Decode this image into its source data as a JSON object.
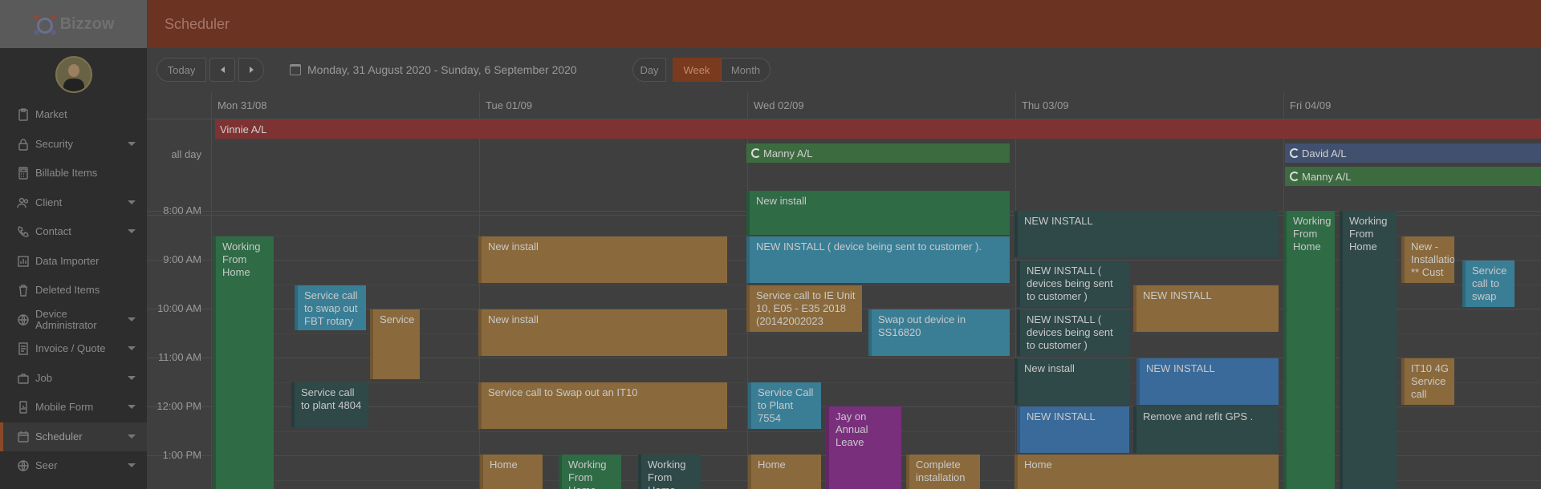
{
  "app": {
    "logo_text": "Bizzow",
    "page_title": "Scheduler"
  },
  "sidebar": {
    "items": [
      {
        "label": "Market",
        "icon": "clipboard-icon",
        "caret": false,
        "active": false
      },
      {
        "label": "Security",
        "icon": "lock-icon",
        "caret": true,
        "active": false
      },
      {
        "label": "Billable Items",
        "icon": "calculator-icon",
        "caret": false,
        "active": false
      },
      {
        "label": "Client",
        "icon": "users-icon",
        "caret": true,
        "active": false
      },
      {
        "label": "Contact",
        "icon": "phone-icon",
        "caret": true,
        "active": false
      },
      {
        "label": "Data Importer",
        "icon": "chart-icon",
        "caret": false,
        "active": false
      },
      {
        "label": "Deleted Items",
        "icon": "trash-icon",
        "caret": false,
        "active": false
      },
      {
        "label": "Device Administrator",
        "icon": "globe-gear-icon",
        "caret": true,
        "active": false
      },
      {
        "label": "Invoice / Quote",
        "icon": "invoice-icon",
        "caret": true,
        "active": false
      },
      {
        "label": "Job",
        "icon": "briefcase-icon",
        "caret": true,
        "active": false
      },
      {
        "label": "Mobile Form",
        "icon": "mobile-chart-icon",
        "caret": true,
        "active": false
      },
      {
        "label": "Scheduler",
        "icon": "calendar-icon",
        "caret": true,
        "active": true
      },
      {
        "label": "Seer",
        "icon": "globe-icon",
        "caret": true,
        "active": false
      }
    ]
  },
  "toolbar": {
    "today": "Today",
    "date_range": "Monday, 31 August 2020 - Sunday, 6 September 2020",
    "views": {
      "day": "Day",
      "week": "Week",
      "month": "Month"
    },
    "active_view": "Week"
  },
  "calendar": {
    "days": [
      "Mon 31/08",
      "Tue 01/09",
      "Wed 02/09",
      "Thu 03/09",
      "Fri 04/09"
    ],
    "allday_label": "all day",
    "times": [
      "8:00 AM",
      "9:00 AM",
      "10:00 AM",
      "11:00 AM",
      "12:00 PM",
      "1:00 PM"
    ],
    "allday_events": [
      {
        "title": "Vinnie A/L",
        "color": "#7e3332",
        "recurring": false
      },
      {
        "title": "Manny A/L",
        "color": "#3d6b40",
        "recurring": true
      },
      {
        "title": "David A/L",
        "color": "#425070",
        "recurring": true
      },
      {
        "title": "Manny A/L",
        "color": "#3d6b40",
        "recurring": true
      }
    ],
    "events": [
      {
        "title": "Working From Home",
        "color": "#2f6b45"
      },
      {
        "title": "Service call to swap out FBT rotary",
        "color": "#3a7e96"
      },
      {
        "title": "Service",
        "color": "#8a6a3c"
      },
      {
        "title": "Service call to plant 4804",
        "color": "#2f4848"
      },
      {
        "title": "New install",
        "color": "#8a6a3c"
      },
      {
        "title": "New install",
        "color": "#8a6a3c"
      },
      {
        "title": "Service call to Swap out an IT10",
        "color": "#8a6a3c"
      },
      {
        "title": "Home",
        "color": "#8a6a3c"
      },
      {
        "title": "Working From Home",
        "color": "#2f6b45"
      },
      {
        "title": "Working From Home",
        "color": "#2f4848"
      },
      {
        "title": "New install",
        "color": "#2f6b45"
      },
      {
        "title": "NEW INSTALL ( device being sent to customer ).",
        "color": "#3a7e96"
      },
      {
        "title": "Service call to IE Unit 10, E05 - E35 2018 (20142002023",
        "color": "#8a6a3c"
      },
      {
        "title": "Swap out device in SS16820",
        "color": "#3a7e96"
      },
      {
        "title": "Service Call to Plant 7554",
        "color": "#3a7e96"
      },
      {
        "title": "Jay on Annual Leave",
        "color": "#7a2f7c"
      },
      {
        "title": "Home",
        "color": "#8a6a3c"
      },
      {
        "title": "Complete installation",
        "color": "#8a6a3c"
      },
      {
        "title": "NEW INSTALL",
        "color": "#2f4848"
      },
      {
        "title": "NEW INSTALL ( devices being sent to customer )",
        "color": "#2f4848"
      },
      {
        "title": "NEW INSTALL",
        "color": "#8a6a3c"
      },
      {
        "title": "NEW INSTALL ( devices being sent to customer )",
        "color": "#2f4848"
      },
      {
        "title": "New install",
        "color": "#2f4848"
      },
      {
        "title": "NEW INSTALL",
        "color": "#3a6a9a"
      },
      {
        "title": "NEW INSTALL",
        "color": "#3a6a9a"
      },
      {
        "title": "Remove and refit GPS .",
        "color": "#2f4848"
      },
      {
        "title": "Home",
        "color": "#8a6a3c"
      },
      {
        "title": "Working From Home",
        "color": "#2f6b45"
      },
      {
        "title": "Working From Home",
        "color": "#2f4848"
      },
      {
        "title": "New - Installatio ** Cust",
        "color": "#8a6a3c"
      },
      {
        "title": "Service call to swap",
        "color": "#3a7e96"
      },
      {
        "title": "IT10 4G Service call",
        "color": "#8a6a3c"
      }
    ]
  }
}
